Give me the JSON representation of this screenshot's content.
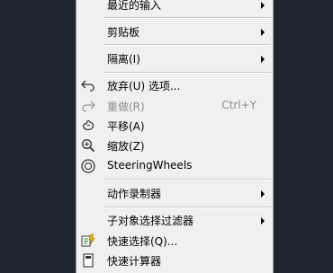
{
  "menu": {
    "recent_input": "最近的输入",
    "clipboard": "剪贴板",
    "isolate": "隔离(I)",
    "undo": "放弃(U) 选项...",
    "redo": "重做(R)",
    "redo_shortcut": "Ctrl+Y",
    "pan": "平移(A)",
    "zoom": "缩放(Z)",
    "steering_wheels": "SteeringWheels",
    "action_recorder": "动作录制器",
    "subobject_filter": "子对象选择过滤器",
    "quick_select": "快速选择(Q)...",
    "quick_calc": "快速计算器"
  }
}
